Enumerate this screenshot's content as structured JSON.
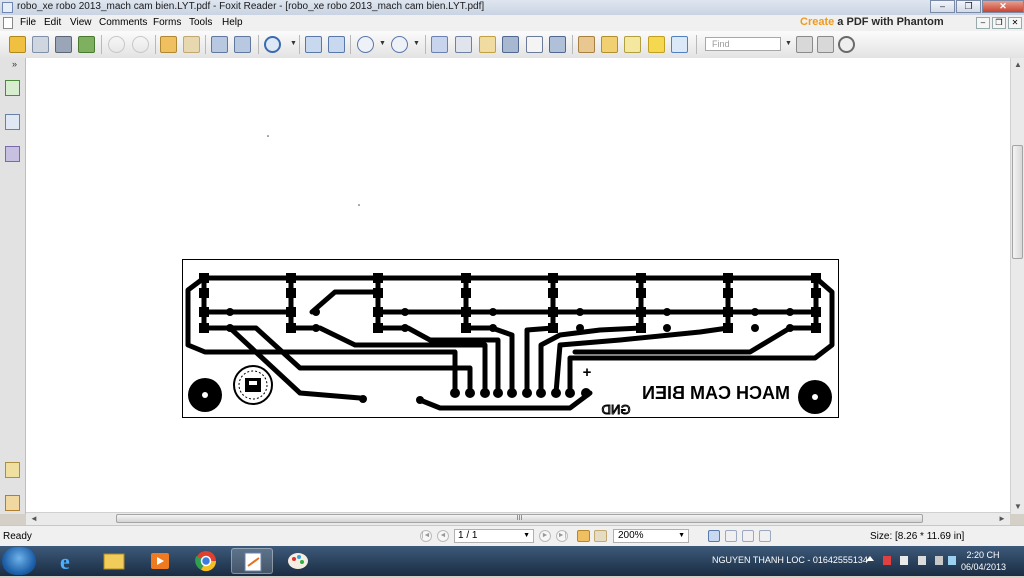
{
  "window": {
    "title": "robo_xe robo 2013_mach cam bien.LYT.pdf - Foxit Reader - [robo_xe robo 2013_mach cam bien.LYT.pdf]",
    "min_symbol": "–",
    "restore_symbol": "❐",
    "close_symbol": "✕"
  },
  "menu": {
    "items": [
      "File",
      "Edit",
      "View",
      "Comments",
      "Forms",
      "Tools",
      "Help"
    ],
    "promo_part1": "Create",
    "promo_part2": " a PDF with Phantom",
    "mdi_min": "–",
    "mdi_restore": "❐",
    "mdi_close": "✕"
  },
  "toolbar": {
    "find_placeholder": "Find"
  },
  "document": {
    "pcb_label": "MACH CAM BIEN",
    "pcb_gnd_label": "GND",
    "pcb_plus_label": "+"
  },
  "scroll": {
    "h_grip": "III",
    "up": "▲",
    "down": "▼",
    "left": "◄",
    "right": "►"
  },
  "status": {
    "ready": "Ready",
    "page": "1 / 1",
    "zoom": "200%",
    "size": "Size: [8.26 * 11.69 in]",
    "dropdown": "▼"
  },
  "taskbar": {
    "user": "NGUYEN THANH LOC - 01642555134",
    "time": "2:20 CH",
    "date": "06/04/2013"
  },
  "colors": {
    "accent_orange": "#f09a1a",
    "pcb_trace": "#000000",
    "taskbar": "#1a2c42"
  }
}
